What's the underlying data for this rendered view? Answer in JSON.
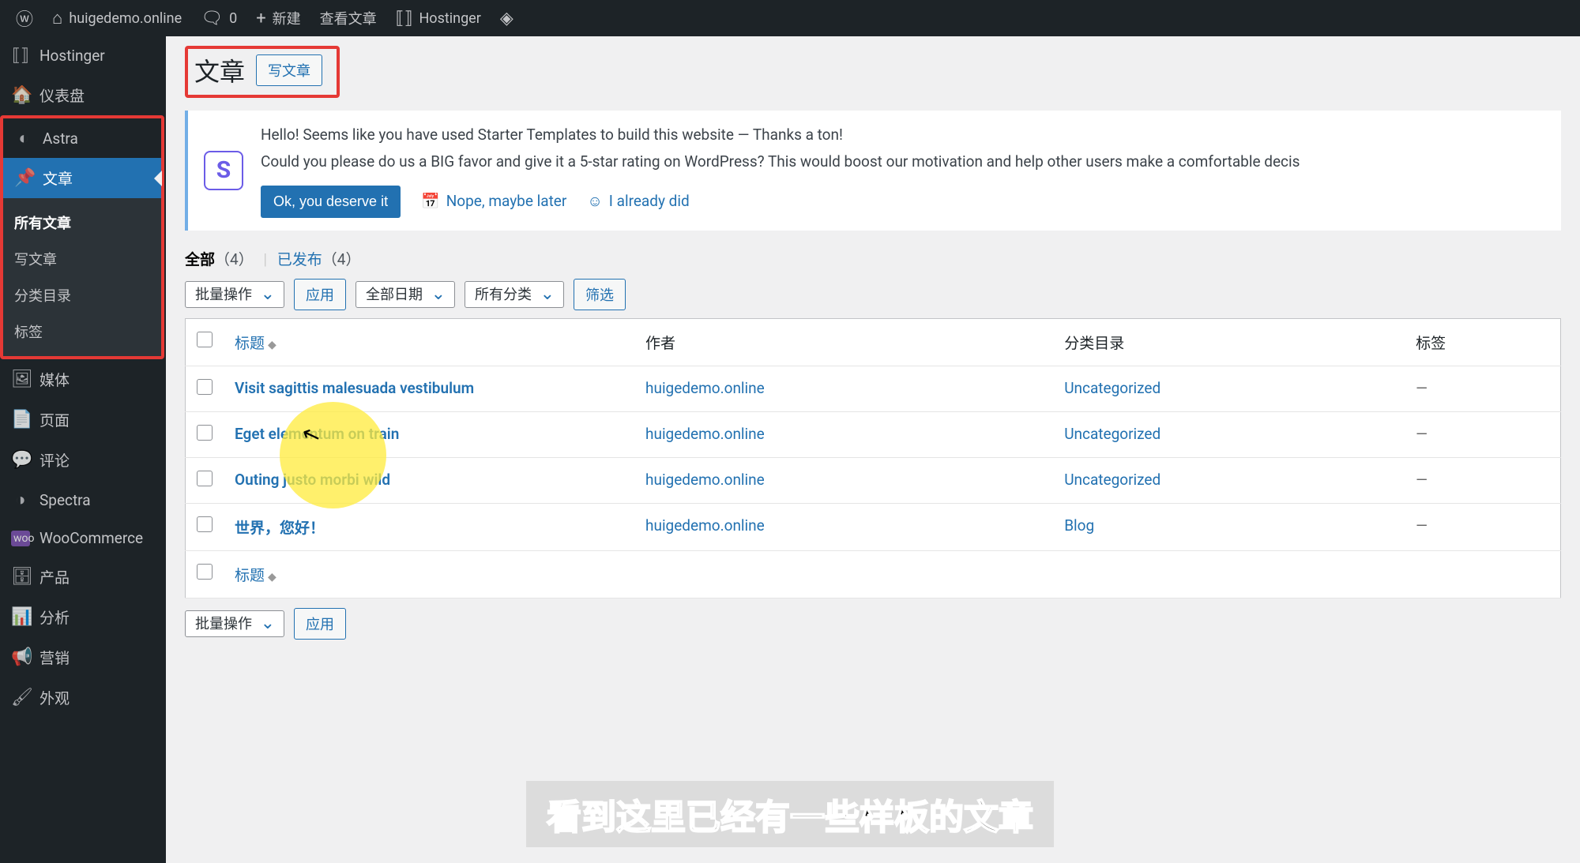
{
  "adminbar": {
    "site_name": "huigedemo.online",
    "comments_count": "0",
    "new": "新建",
    "view_post": "查看文章",
    "hostinger": "Hostinger"
  },
  "sidebar": {
    "hostinger": "Hostinger",
    "dashboard": "仪表盘",
    "astra": "Astra",
    "posts": "文章",
    "posts_sub": {
      "all": "所有文章",
      "new": "写文章",
      "categories": "分类目录",
      "tags": "标签"
    },
    "media": "媒体",
    "pages": "页面",
    "comments": "评论",
    "spectra": "Spectra",
    "woocommerce": "WooCommerce",
    "products": "产品",
    "analytics": "分析",
    "marketing": "营销",
    "appearance": "外观"
  },
  "header": {
    "title": "文章",
    "add_new": "写文章"
  },
  "notice": {
    "line1": "Hello! Seems like you have used Starter Templates to build this website — Thanks a ton!",
    "line2": "Could you please do us a BIG favor and give it a 5-star rating on WordPress? This would boost our motivation and help other users make a comfortable decis",
    "ok": "Ok, you deserve it",
    "nope": "Nope, maybe later",
    "already": "I already did"
  },
  "filters": {
    "all": "全部",
    "all_count": "（4）",
    "published": "已发布",
    "published_count": "（4）"
  },
  "bulk": {
    "action_placeholder": "批量操作",
    "apply": "应用",
    "all_dates": "全部日期",
    "all_cats": "所有分类",
    "filter": "筛选"
  },
  "table": {
    "cols": {
      "title": "标题",
      "author": "作者",
      "category": "分类目录",
      "tags": "标签"
    },
    "rows": [
      {
        "title": "Visit sagittis malesuada vestibulum",
        "author": "huigedemo.online",
        "category": "Uncategorized",
        "tags": "—"
      },
      {
        "title": "Eget elementum on train",
        "author": "huigedemo.online",
        "category": "Uncategorized",
        "tags": "—"
      },
      {
        "title": "Outing justo morbi wild",
        "author": "huigedemo.online",
        "category": "Uncategorized",
        "tags": "—"
      },
      {
        "title": "世界，您好！",
        "author": "huigedemo.online",
        "category": "Blog",
        "tags": "—"
      }
    ]
  },
  "subtitle": "看到这里已经有一些样板的文章"
}
